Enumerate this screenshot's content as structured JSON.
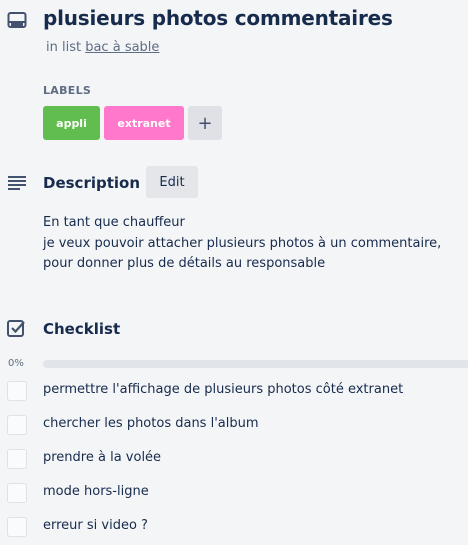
{
  "card": {
    "title": "plusieurs photos commentaires",
    "in_list_prefix": "in list",
    "list_name": "bac à sable"
  },
  "labels": {
    "heading": "LABELS",
    "items": [
      {
        "text": "appli",
        "color": "#61bd4f"
      },
      {
        "text": "extranet",
        "color": "#ff78cb"
      }
    ],
    "add_symbol": "+"
  },
  "description": {
    "heading": "Description",
    "edit_label": "Edit",
    "lines": [
      "En tant que chauffeur",
      "je veux pouvoir attacher plusieurs photos à un commentaire,",
      "pour donner plus de détails au responsable"
    ]
  },
  "checklist": {
    "heading": "Checklist",
    "progress_label": "0%",
    "progress": 0,
    "items": [
      "permettre l'affichage de plusieurs photos côté extranet",
      "chercher les photos dans l'album",
      "prendre à la volée",
      "mode hors-ligne",
      "erreur si video ?"
    ]
  },
  "colors": {
    "accent_green": "#61bd4f",
    "accent_pink": "#ff78cb",
    "text": "#172b4d",
    "muted": "#5e6c84"
  }
}
